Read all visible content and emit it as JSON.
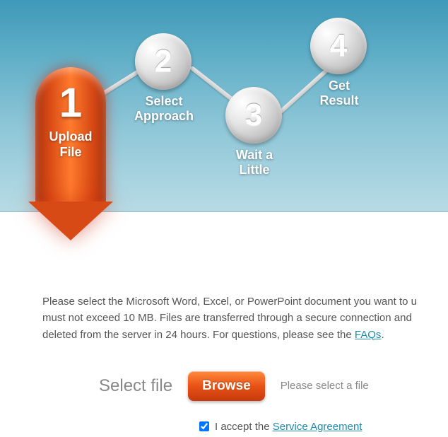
{
  "steps": {
    "s1": {
      "num": "1",
      "label_l1": "Upload",
      "label_l2": "File"
    },
    "s2": {
      "num": "2",
      "label_l1": "Select",
      "label_l2": "Approach"
    },
    "s3": {
      "num": "3",
      "label_l1": "Wait a",
      "label_l2": "Little"
    },
    "s4": {
      "num": "4",
      "label_l1": "Get",
      "label_l2": "Result"
    }
  },
  "description": {
    "line1": "Please select the Microsoft Word, Excel, or PowerPoint document you want to u",
    "line2": "must not exceed 10 MB. Files are transferred through a secure connection and ",
    "line3_pre": "deleted from the server in 24 hours. For questions, please see the ",
    "faqs_link": "FAQs",
    "line3_post": "."
  },
  "form": {
    "select_label": "Select file",
    "browse_label": "Browse",
    "file_status": "Please select a file",
    "accept_prefix": "I accept the ",
    "agreement_link": "Service Agreement",
    "accept_checked": true
  }
}
